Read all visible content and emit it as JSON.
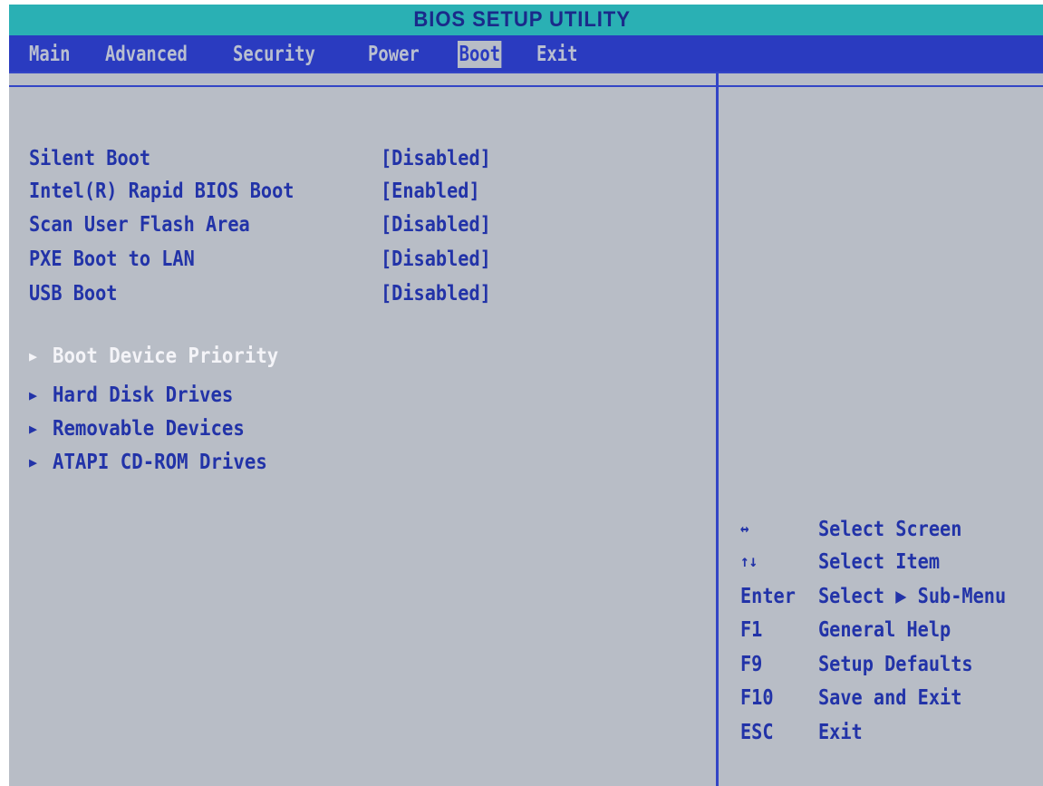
{
  "title": "BIOS SETUP UTILITY",
  "tabs": [
    {
      "label": "Main"
    },
    {
      "label": "Advanced"
    },
    {
      "label": "Security"
    },
    {
      "label": "Power"
    },
    {
      "label": "Boot"
    },
    {
      "label": "Exit"
    }
  ],
  "active_tab": "Boot",
  "options": [
    {
      "label": "Silent Boot",
      "value": "[Disabled]"
    },
    {
      "label": "Intel(R) Rapid BIOS Boot",
      "value": "[Enabled]"
    },
    {
      "label": "Scan User Flash Area",
      "value": "[Disabled]"
    },
    {
      "label": "PXE Boot to LAN",
      "value": "[Disabled]"
    },
    {
      "label": "USB Boot",
      "value": "[Disabled]"
    }
  ],
  "submenus": [
    {
      "arrow": "▶",
      "label": "Boot Device Priority"
    },
    {
      "arrow": "▶",
      "label": "Hard Disk Drives"
    },
    {
      "arrow": "▶",
      "label": "Removable Devices"
    },
    {
      "arrow": "▶",
      "label": "ATAPI CD-ROM Drives"
    }
  ],
  "selected_submenu": "Boot Device Priority",
  "help": [
    {
      "key": "↔",
      "action": "Select Screen"
    },
    {
      "key": "↑↓",
      "action": "Select Item"
    },
    {
      "key": "Enter",
      "action": "Select ▶ Sub-Menu"
    },
    {
      "key": "F1",
      "action": "General Help"
    },
    {
      "key": "F9",
      "action": "Setup Defaults"
    },
    {
      "key": "F10",
      "action": "Save and Exit"
    },
    {
      "key": "ESC",
      "action": "Exit"
    }
  ],
  "colors": {
    "title_bar": "#2ab0b4",
    "menu_bar": "#2a3bc0",
    "panel": "#b8bdc6",
    "text": "#2233a8",
    "highlight": "#f4f4f8"
  }
}
